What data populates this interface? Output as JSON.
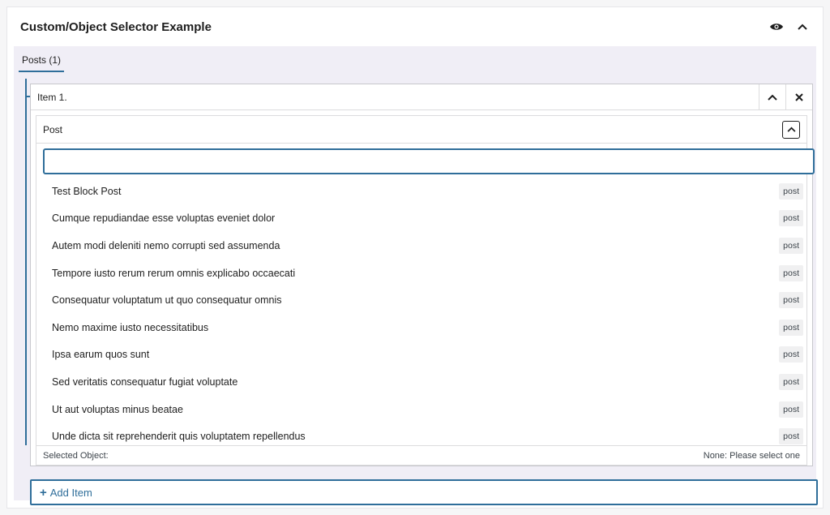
{
  "panel": {
    "title": "Custom/Object Selector Example",
    "visibility_icon": "eye-icon",
    "collapse_icon": "chevron-up-icon"
  },
  "group": {
    "tab_label": "Posts (1)"
  },
  "item": {
    "title": "Item 1.",
    "collapse_icon": "chevron-up-icon",
    "remove_icon": "close-icon"
  },
  "field": {
    "label": "Post",
    "search": {
      "value": "",
      "placeholder": ""
    },
    "results": [
      {
        "title": "Test Block Post",
        "type": "post"
      },
      {
        "title": "Cumque repudiandae esse voluptas eveniet dolor",
        "type": "post"
      },
      {
        "title": "Autem modi deleniti nemo corrupti sed assumenda",
        "type": "post"
      },
      {
        "title": "Tempore iusto rerum rerum omnis explicabo occaecati",
        "type": "post"
      },
      {
        "title": "Consequatur voluptatum ut quo consequatur omnis",
        "type": "post"
      },
      {
        "title": "Nemo maxime iusto necessitatibus",
        "type": "post"
      },
      {
        "title": "Ipsa earum quos sunt",
        "type": "post"
      },
      {
        "title": "Sed veritatis consequatur fugiat voluptate",
        "type": "post"
      },
      {
        "title": "Ut aut voluptas minus beatae",
        "type": "post"
      },
      {
        "title": "Unde dicta sit reprehenderit quis voluptatem repellendus",
        "type": "post"
      }
    ],
    "footer": {
      "label": "Selected Object:",
      "value": "None: Please select one"
    }
  },
  "add_item": {
    "label": "Add Item",
    "icon": "plus-icon"
  },
  "colors": {
    "accent": "#2f6e9a",
    "body_bg": "#f0eef6"
  }
}
